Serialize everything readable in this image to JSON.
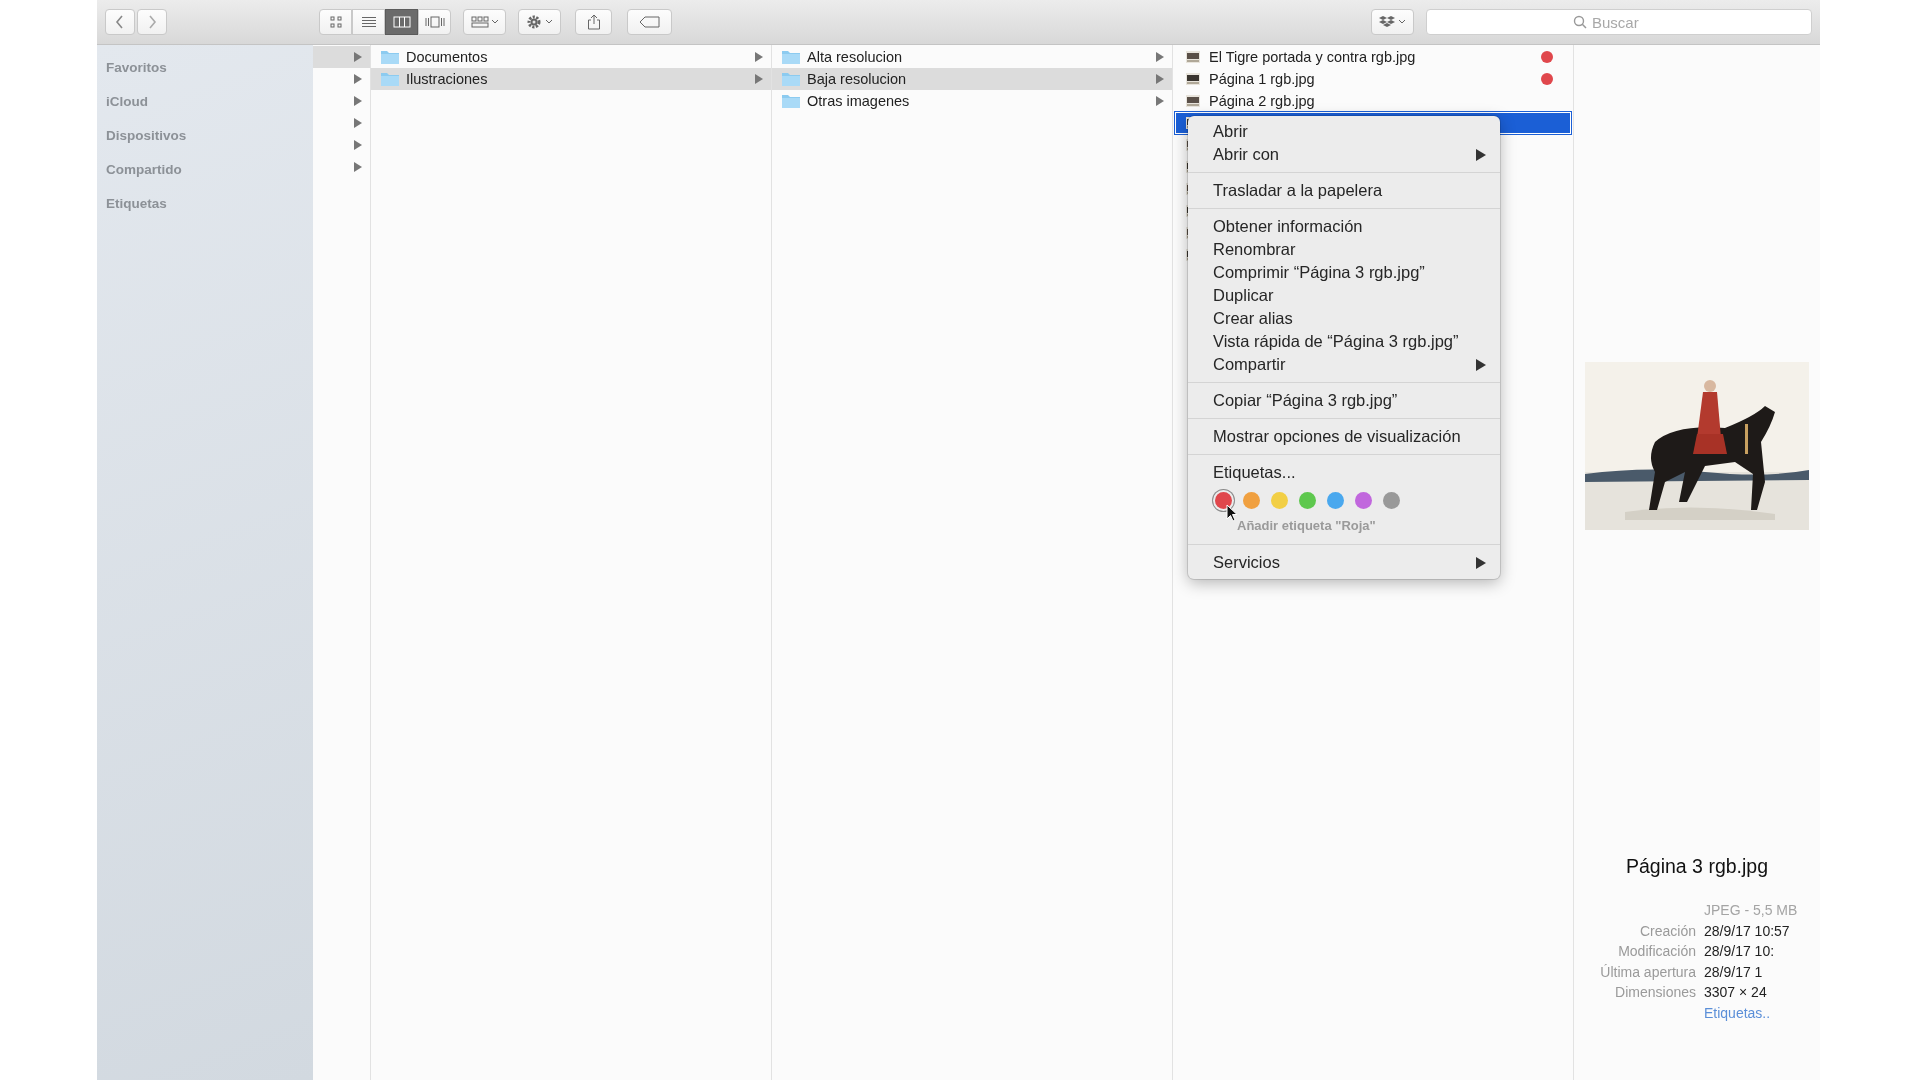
{
  "toolbar": {
    "view_modes": [
      {
        "kind": "icons",
        "selected": false
      },
      {
        "kind": "list",
        "selected": false
      },
      {
        "kind": "columns",
        "selected": true
      },
      {
        "kind": "coverflow",
        "selected": false
      }
    ],
    "search": {
      "placeholder": "Buscar"
    }
  },
  "sidebar": {
    "sections": [
      "Favoritos",
      "iCloud",
      "Dispositivos",
      "Compartido",
      "Etiquetas"
    ]
  },
  "parent_column": {
    "rows": [
      {
        "selected": true
      },
      {
        "selected": false
      },
      {
        "selected": false
      },
      {
        "selected": false
      },
      {
        "selected": false
      },
      {
        "selected": false
      }
    ]
  },
  "folder_columns": [
    {
      "rows": [
        {
          "name": "Documentos",
          "selected": false
        },
        {
          "name": "Ilustraciones",
          "selected": true
        }
      ]
    },
    {
      "rows": [
        {
          "name": "Alta resolucion",
          "selected": false
        },
        {
          "name": "Baja resolucion",
          "selected": true
        },
        {
          "name": "Otras imagenes",
          "selected": false
        }
      ]
    }
  ],
  "file_column": {
    "rows": [
      {
        "name": "El Tigre portada y contra rgb.jpg",
        "selected": false,
        "color": "#e0474c"
      },
      {
        "name": "Página 1 rgb.jpg",
        "selected": false,
        "color": "#e0474c"
      },
      {
        "name": "Página 2 rgb.jpg",
        "selected": false
      },
      {
        "selected": true
      },
      {
        "selected": false
      },
      {
        "selected": false
      },
      {
        "selected": false
      },
      {
        "selected": false
      },
      {
        "selected": false
      },
      {
        "selected": false
      }
    ]
  },
  "context_menu": {
    "items": [
      {
        "kind": "item",
        "label": "Abrir"
      },
      {
        "kind": "submenu",
        "label": "Abrir con"
      },
      {
        "kind": "separator"
      },
      {
        "kind": "item",
        "label": "Trasladar a la papelera"
      },
      {
        "kind": "separator"
      },
      {
        "kind": "item",
        "label": "Obtener información"
      },
      {
        "kind": "item",
        "label": "Renombrar"
      },
      {
        "kind": "item",
        "label": "Comprimir “Página 3 rgb.jpg”"
      },
      {
        "kind": "item",
        "label": "Duplicar"
      },
      {
        "kind": "item",
        "label": "Crear alias"
      },
      {
        "kind": "item",
        "label": "Vista rápida de “Página 3 rgb.jpg”"
      },
      {
        "kind": "submenu",
        "label": "Compartir"
      },
      {
        "kind": "separator"
      },
      {
        "kind": "item",
        "label": "Copiar “Página 3 rgb.jpg”"
      },
      {
        "kind": "separator"
      },
      {
        "kind": "item",
        "label": "Mostrar opciones de visualización"
      },
      {
        "kind": "separator"
      },
      {
        "kind": "item",
        "label": "Etiquetas..."
      },
      {
        "kind": "tags",
        "tags": [
          {
            "color": "#e0474c",
            "hovered": true
          },
          {
            "color": "#f0a040",
            "hovered": false
          },
          {
            "color": "#f2cf45",
            "hovered": false
          },
          {
            "color": "#5ec84e",
            "hovered": false
          },
          {
            "color": "#4aa8ee",
            "hovered": false
          },
          {
            "color": "#c167dd",
            "hovered": false
          },
          {
            "color": "#999999",
            "hovered": false
          }
        ]
      },
      {
        "kind": "hint",
        "label": "Añadir etiqueta \"Roja\""
      },
      {
        "kind": "separator"
      },
      {
        "kind": "submenu",
        "label": "Servicios"
      }
    ]
  },
  "preview": {
    "name": "Página 3 rgb.jpg",
    "kind_size": "JPEG - 5,5 MB",
    "info": [
      {
        "label": "Creación",
        "value": "28/9/17 10:57"
      },
      {
        "label": "Modificación",
        "value": "28/9/17 10:"
      },
      {
        "label": "Última apertura",
        "value": "28/9/17 1"
      },
      {
        "label": "Dimensiones",
        "value": "3307 × 24"
      }
    ],
    "tags_link": "Etiquetas.."
  }
}
